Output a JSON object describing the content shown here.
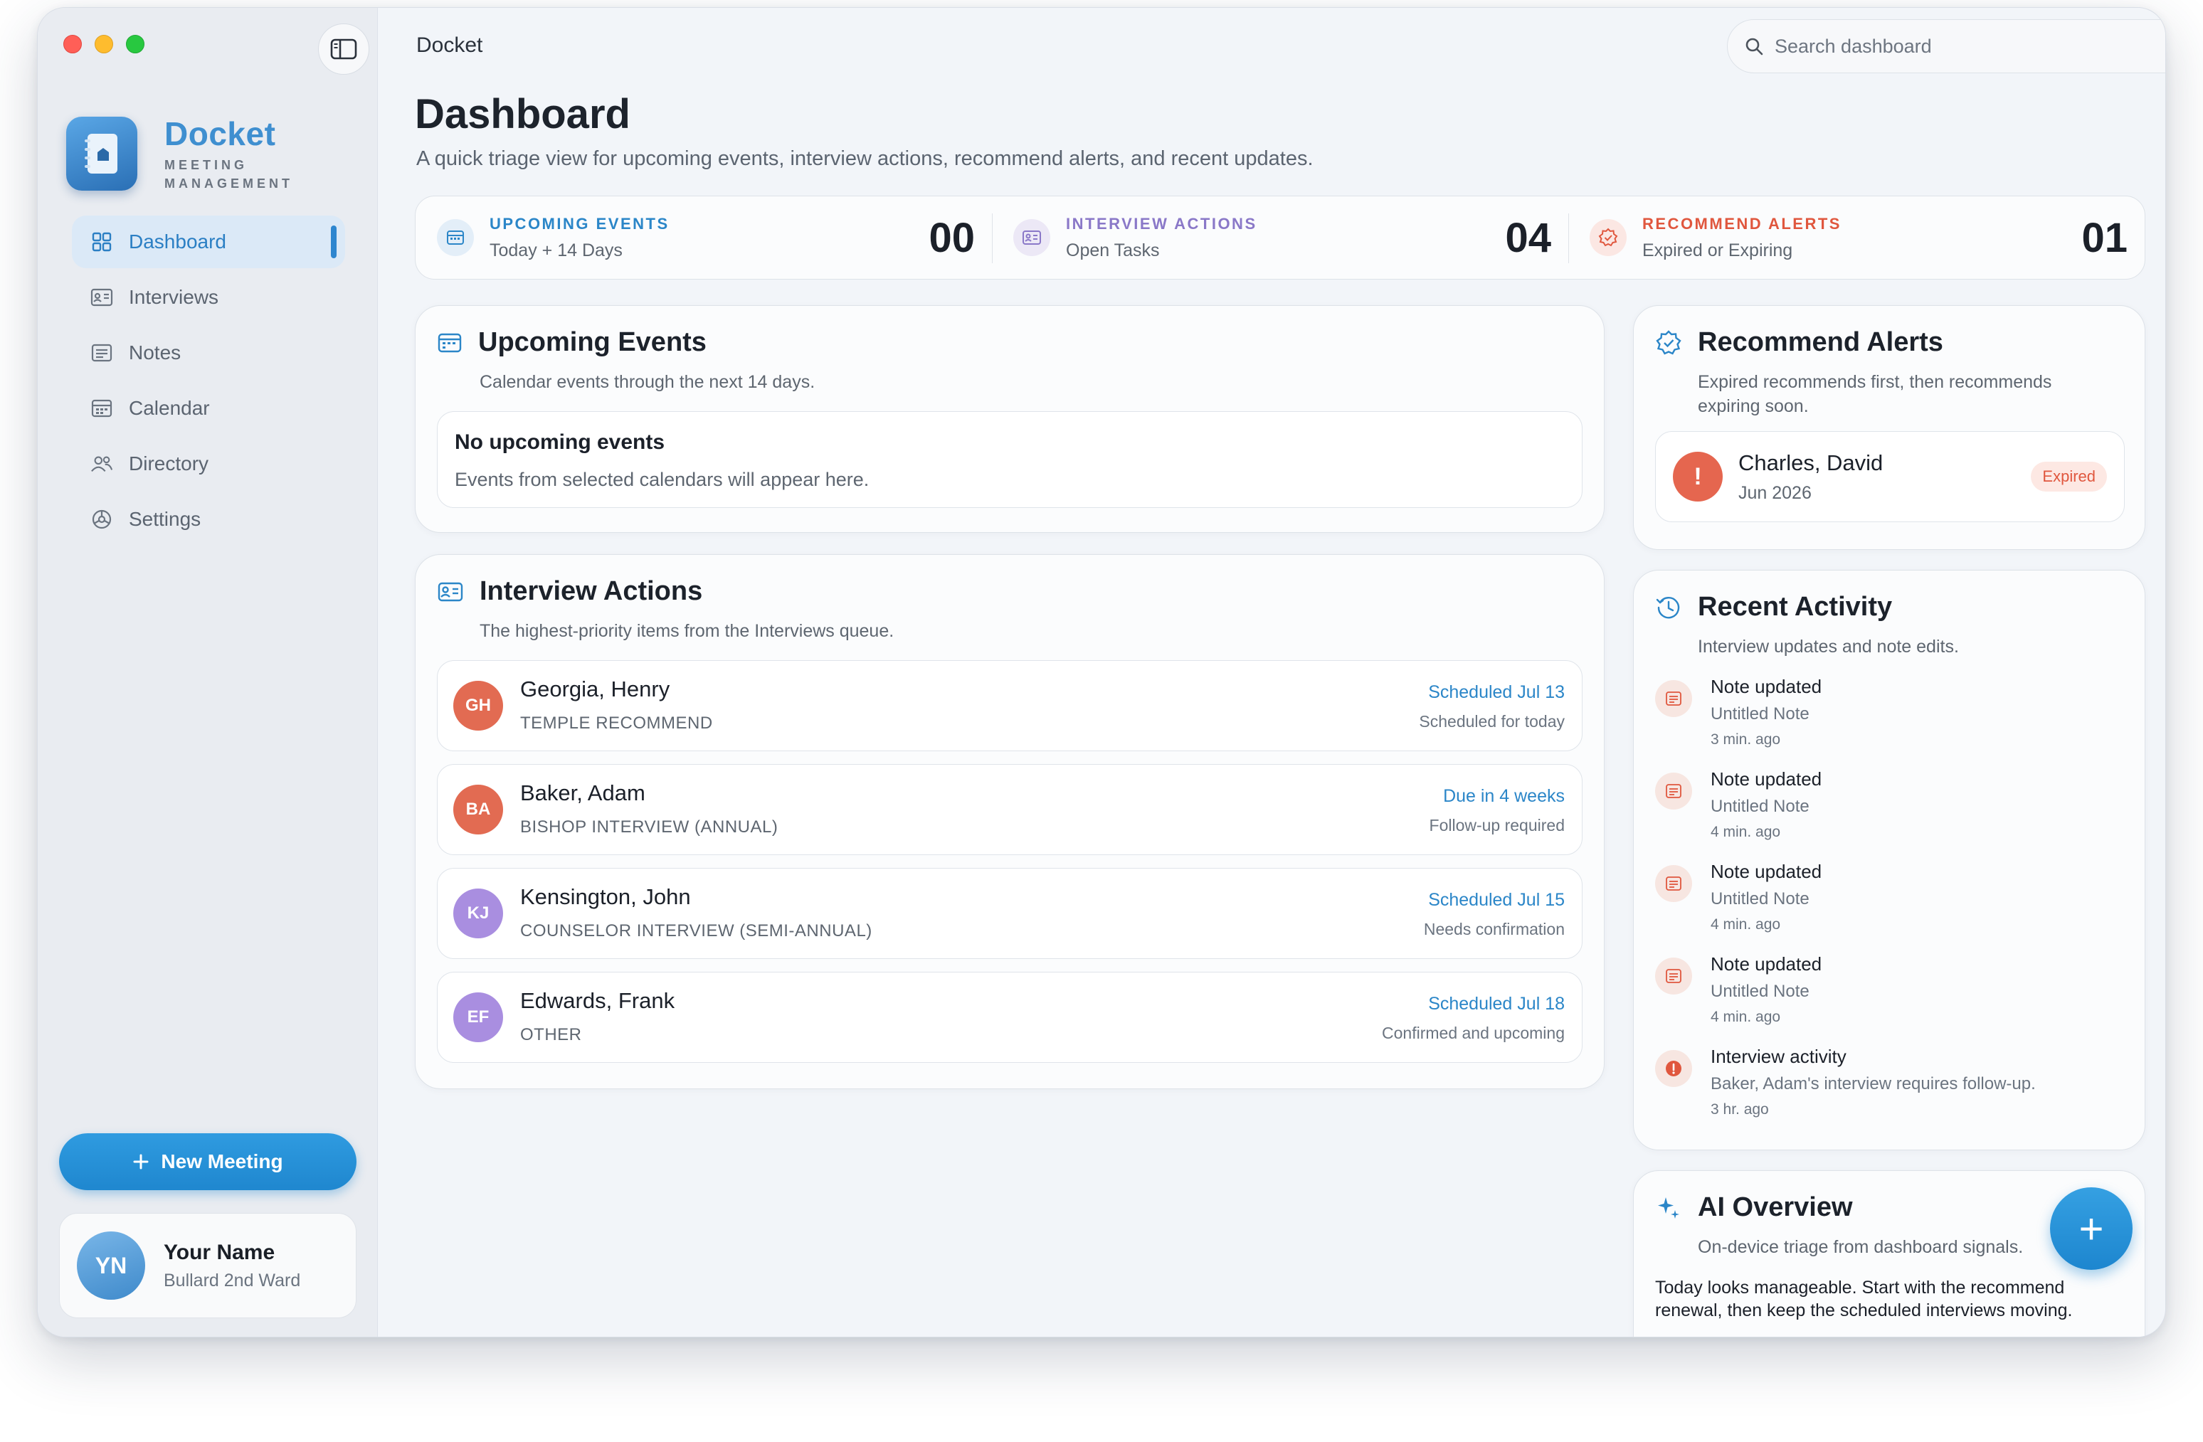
{
  "window": {
    "title": "Docket"
  },
  "brand": {
    "name": "Docket",
    "tagline_line1": "MEETING",
    "tagline_line2": "MANAGEMENT"
  },
  "sidebar": {
    "items": [
      {
        "label": "Dashboard",
        "icon": "grid-icon",
        "active": true
      },
      {
        "label": "Interviews",
        "icon": "id-card-icon"
      },
      {
        "label": "Notes",
        "icon": "note-icon"
      },
      {
        "label": "Calendar",
        "icon": "calendar-icon"
      },
      {
        "label": "Directory",
        "icon": "people-icon"
      },
      {
        "label": "Settings",
        "icon": "gear-icon"
      }
    ],
    "new_meeting_label": "New Meeting",
    "profile": {
      "initials": "YN",
      "name": "Your Name",
      "ward": "Bullard 2nd Ward"
    }
  },
  "search": {
    "placeholder": "Search dashboard"
  },
  "page": {
    "title": "Dashboard",
    "subtitle": "A quick triage view for upcoming events, interview actions, recommend alerts, and recent updates."
  },
  "stats": [
    {
      "label": "UPCOMING EVENTS",
      "sub": "Today + 14 Days",
      "value": "00",
      "color": "#2b86c8"
    },
    {
      "label": "INTERVIEW ACTIONS",
      "sub": "Open Tasks",
      "value": "04",
      "color": "#8a78c8"
    },
    {
      "label": "RECOMMEND ALERTS",
      "sub": "Expired or Expiring",
      "value": "01",
      "color": "#e0573e"
    }
  ],
  "upcoming": {
    "title": "Upcoming Events",
    "subtitle": "Calendar events through the next 14 days.",
    "empty_title": "No upcoming events",
    "empty_text": "Events from selected calendars will appear here."
  },
  "interviews": {
    "title": "Interview Actions",
    "subtitle": "The highest-priority items from the Interviews queue.",
    "rows": [
      {
        "initials": "GH",
        "name": "Georgia, Henry",
        "type": "TEMPLE RECOMMEND",
        "status": "Scheduled Jul 13",
        "note": "Scheduled for today",
        "color": "#e26b52"
      },
      {
        "initials": "BA",
        "name": "Baker, Adam",
        "type": "BISHOP INTERVIEW (ANNUAL)",
        "status": "Due in 4 weeks",
        "note": "Follow-up required",
        "color": "#e26b52"
      },
      {
        "initials": "KJ",
        "name": "Kensington, John",
        "type": "COUNSELOR INTERVIEW (SEMI-ANNUAL)",
        "status": "Scheduled Jul 15",
        "note": "Needs confirmation",
        "color": "#a98ee0"
      },
      {
        "initials": "EF",
        "name": "Edwards, Frank",
        "type": "OTHER",
        "status": "Scheduled Jul 18",
        "note": "Confirmed and upcoming",
        "color": "#a98ee0"
      }
    ]
  },
  "alerts": {
    "title": "Recommend Alerts",
    "subtitle_line1": "Expired recommends first, then recommends",
    "subtitle_line2": "expiring soon.",
    "item": {
      "name": "Charles, David",
      "date": "Jun 2026",
      "badge": "Expired"
    }
  },
  "activity": {
    "title": "Recent Activity",
    "subtitle": "Interview updates and note edits.",
    "items": [
      {
        "title": "Note updated",
        "detail": "Untitled Note",
        "time": "3 min. ago",
        "kind": "note"
      },
      {
        "title": "Note updated",
        "detail": "Untitled Note",
        "time": "4 min. ago",
        "kind": "note"
      },
      {
        "title": "Note updated",
        "detail": "Untitled Note",
        "time": "4 min. ago",
        "kind": "note"
      },
      {
        "title": "Note updated",
        "detail": "Untitled Note",
        "time": "4 min. ago",
        "kind": "note"
      },
      {
        "title": "Interview activity",
        "detail": "Baker, Adam's interview requires follow-up.",
        "time": "3 hr. ago",
        "kind": "alert"
      }
    ]
  },
  "ai": {
    "title": "AI Overview",
    "subtitle": "On-device triage from dashboard signals.",
    "text": "Today looks manageable. Start with the recommend renewal, then keep the scheduled interviews moving."
  },
  "fab": {
    "label": "+"
  }
}
